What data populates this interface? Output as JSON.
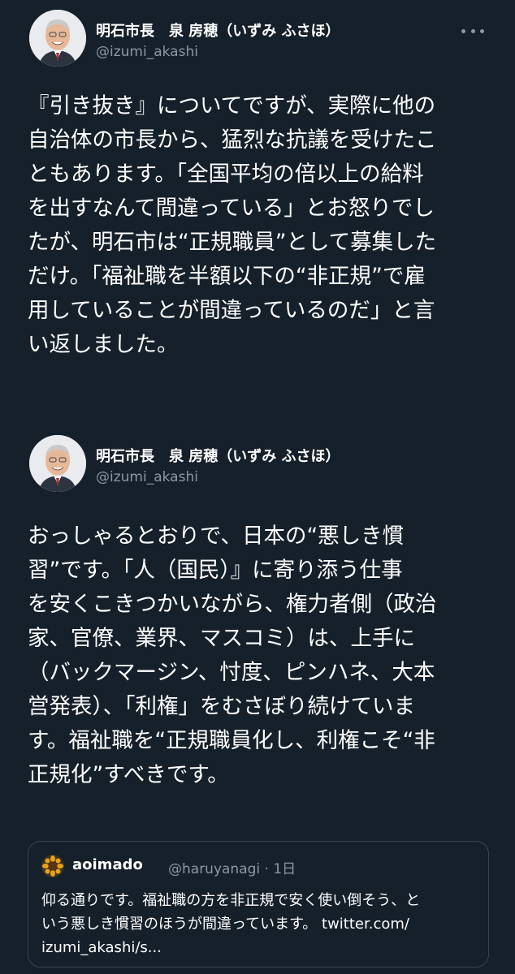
{
  "tweets": [
    {
      "author_name": "明石市長　泉 房穂（いずみ ふさほ）",
      "handle": "@izumi_akashi",
      "text": "『引き抜き』についてですが、実際に他の\n自治体の市長から、猛烈な抗議を受けたこ\nともあります。「全国平均の倍以上の給料\nを出すなんて間違っている」とお怒りでし\nたが、明石市は“正規職員”として募集した\nだけ。「福祉職を半額以下の“非正規”で雇\n用していることが間違っているのだ」と言\nい返しました。"
    },
    {
      "author_name": "明石市長　泉 房穂（いずみ ふさほ）",
      "handle": "@izumi_akashi",
      "text": "おっしゃるとおりで、日本の“悪しき慣\n習”です。「人（国民）』に寄り添う仕事\nを安くこきつかいながら、権力者側（政治\n家、官僚、業界、マスコミ）は、上手に\n（バックマージン、忖度、ピンハネ、大本\n営発表）、「利権」をむさぼり続けていま\nす。福祉職を“正規職員化し、利権こそ“非\n正規化”すべきです。"
    }
  ],
  "quote": {
    "author_name": "aoimado",
    "meta": "@haruyanagi · 1日",
    "text": "仰る通りです。福祉職の方を非正規で安く使い倒そう、と\nいう悪しき慣習のほうが間違っています。 twitter.com/\nizumi_akashi/s..."
  },
  "icons": {
    "avatar": "profile-photo",
    "more": "more-horizontal-icon",
    "quote_avatar": "sunflower-avatar"
  },
  "colors": {
    "background": "#15202b",
    "text": "#ffffff",
    "secondary": "#8b98a5",
    "border": "#38444d"
  }
}
